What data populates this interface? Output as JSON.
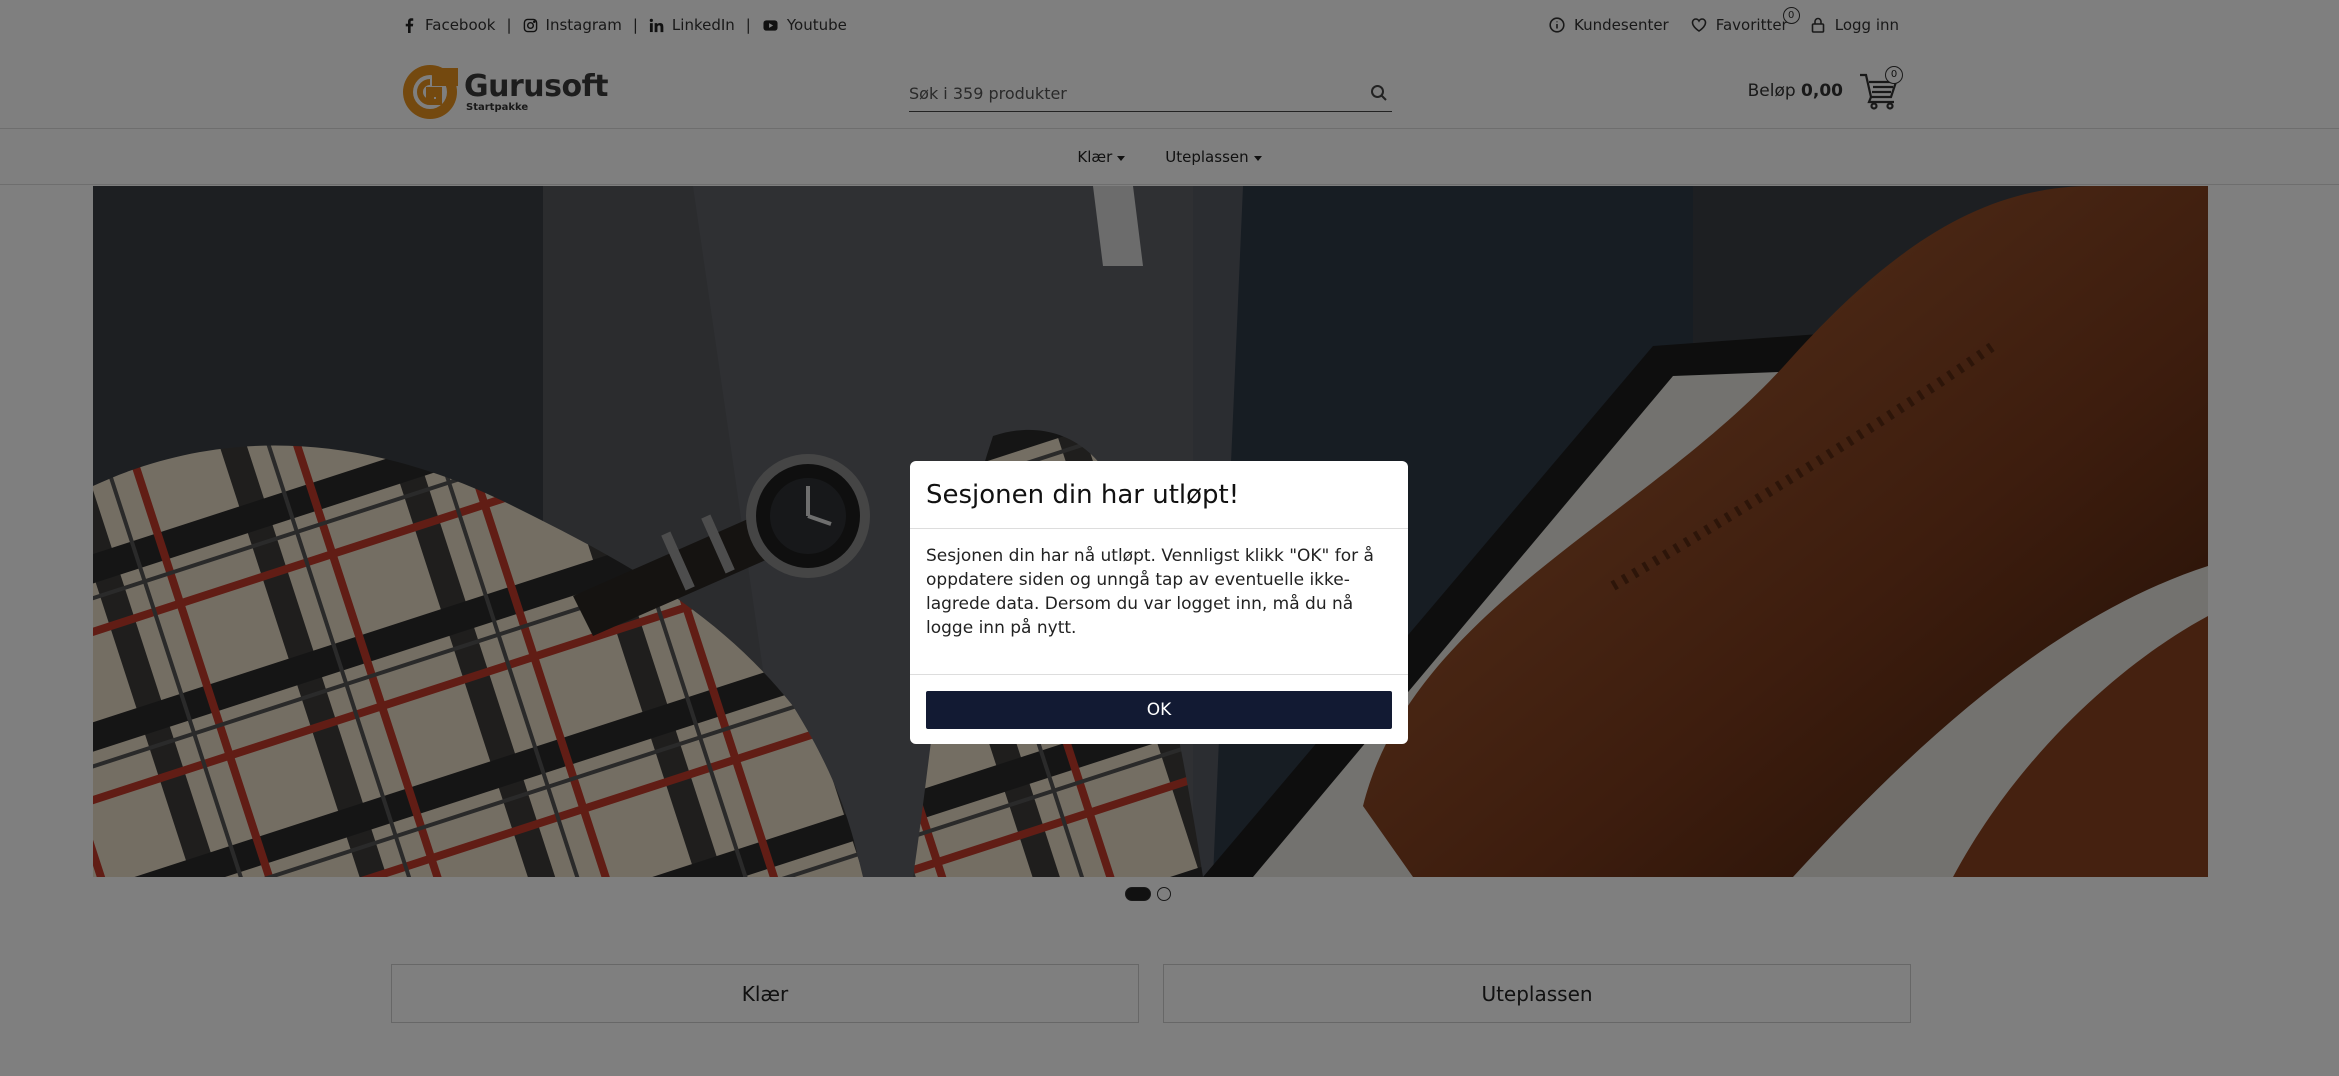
{
  "topbar": {
    "social": [
      {
        "label": "Facebook",
        "icon": "facebook-icon"
      },
      {
        "label": "Instagram",
        "icon": "instagram-icon"
      },
      {
        "label": "LinkedIn",
        "icon": "linkedin-icon"
      },
      {
        "label": "Youtube",
        "icon": "youtube-icon"
      }
    ],
    "separator": "|",
    "account": {
      "customer_center": "Kundesenter",
      "favorites": "Favoritter",
      "favorites_count": "0",
      "login": "Logg inn"
    }
  },
  "header": {
    "logo_name": "Gurusoft",
    "logo_sub": "Startpakke",
    "search_placeholder": "Søk i 359 produkter",
    "amount_label": "Beløp",
    "amount_value": "0,00",
    "cart_count": "0"
  },
  "nav": {
    "items": [
      {
        "label": "Klær"
      },
      {
        "label": "Uteplassen"
      }
    ]
  },
  "carousel": {
    "slide_count": 2,
    "active_index": 0
  },
  "categories": [
    {
      "label": "Klær"
    },
    {
      "label": "Uteplassen"
    }
  ],
  "modal": {
    "title": "Sesjonen din har utløpt!",
    "body": "Sesjonen din har nå utløpt. Vennligst klikk \"OK\" for å oppdatere siden og unngå tap av eventuelle ikke-lagrede data. Dersom du var logget inn, må du nå logge inn på nytt.",
    "ok_label": "OK"
  },
  "colors": {
    "accent": "#e8931e",
    "primary_button": "#121a33",
    "overlay": "rgba(0,0,0,0.5)"
  }
}
